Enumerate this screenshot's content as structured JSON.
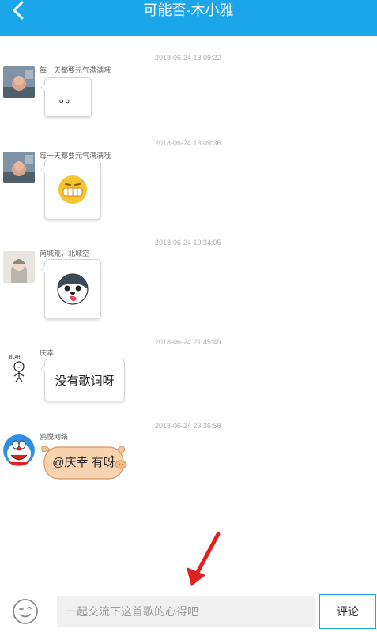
{
  "header": {
    "title": "可能否-木小雅"
  },
  "messages": [
    {
      "timestamp": "2018-06-24 13:09:22",
      "username": "每一天都要元气满满哦",
      "content": "。。",
      "type": "text"
    },
    {
      "timestamp": "2018-06-24 13:09:36",
      "username": "每一天都要元气满满哦",
      "content_icon": "sweating-face-emoji",
      "type": "emoji"
    },
    {
      "timestamp": "2018-06-24 19:34:05",
      "username": "南城荒，北城空",
      "content_icon": "husky-tongue-sticker",
      "type": "emoji"
    },
    {
      "timestamp": "2018-06-24 21:45:49",
      "username": "庆幸",
      "content": "没有歌词呀",
      "type": "text"
    },
    {
      "timestamp": "2018-06-24 23:36:58",
      "username": "鸥悦网络",
      "content": "@庆幸 有呀",
      "type": "text-pig-bubble"
    }
  ],
  "footer": {
    "emoji_icon": "smiley-face-icon",
    "input_placeholder": "一起交流下这首歌的心得吧",
    "submit_label": "评论"
  },
  "annotation": {
    "arrow_icon": "red-arrow-icon",
    "color": "#e02020"
  },
  "colors": {
    "accent": "#1aa6e8"
  }
}
